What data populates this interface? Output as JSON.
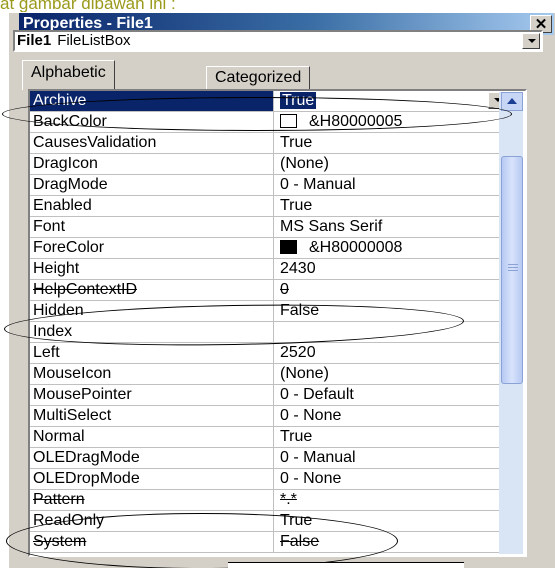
{
  "caption": "at gambar dibawah ini :",
  "window": {
    "title": "Properties - File1",
    "close_symbol": "✕"
  },
  "object_selector": {
    "name": "File1",
    "type": "FileListBox"
  },
  "tabs": [
    {
      "label": "Alphabetic",
      "active": true
    },
    {
      "label": "Categorized",
      "active": false
    }
  ],
  "properties": [
    {
      "name": "Archive",
      "value": "True",
      "selected": true
    },
    {
      "name": "BackColor",
      "value": "&H80000005",
      "swatch": "#ffffff"
    },
    {
      "name": "CausesValidation",
      "value": "True"
    },
    {
      "name": "DragIcon",
      "value": "(None)"
    },
    {
      "name": "DragMode",
      "value": "0 - Manual"
    },
    {
      "name": "Enabled",
      "value": "True"
    },
    {
      "name": "Font",
      "value": "MS Sans Serif"
    },
    {
      "name": "ForeColor",
      "value": "&H80000008",
      "swatch": "#000000"
    },
    {
      "name": "Height",
      "value": "2430"
    },
    {
      "name": "HelpContextID",
      "value": "0",
      "struck": true
    },
    {
      "name": "Hidden",
      "value": "False"
    },
    {
      "name": "Index",
      "value": ""
    },
    {
      "name": "Left",
      "value": "2520"
    },
    {
      "name": "MouseIcon",
      "value": "(None)"
    },
    {
      "name": "MousePointer",
      "value": "0 - Default"
    },
    {
      "name": "MultiSelect",
      "value": "0 - None"
    },
    {
      "name": "Normal",
      "value": "True"
    },
    {
      "name": "OLEDragMode",
      "value": "0 - Manual"
    },
    {
      "name": "OLEDropMode",
      "value": "0 - None"
    },
    {
      "name": "Pattern",
      "value": "*.*",
      "struck": true
    },
    {
      "name": "ReadOnly",
      "value": "True"
    },
    {
      "name": "System",
      "value": "False",
      "struck": true
    }
  ]
}
